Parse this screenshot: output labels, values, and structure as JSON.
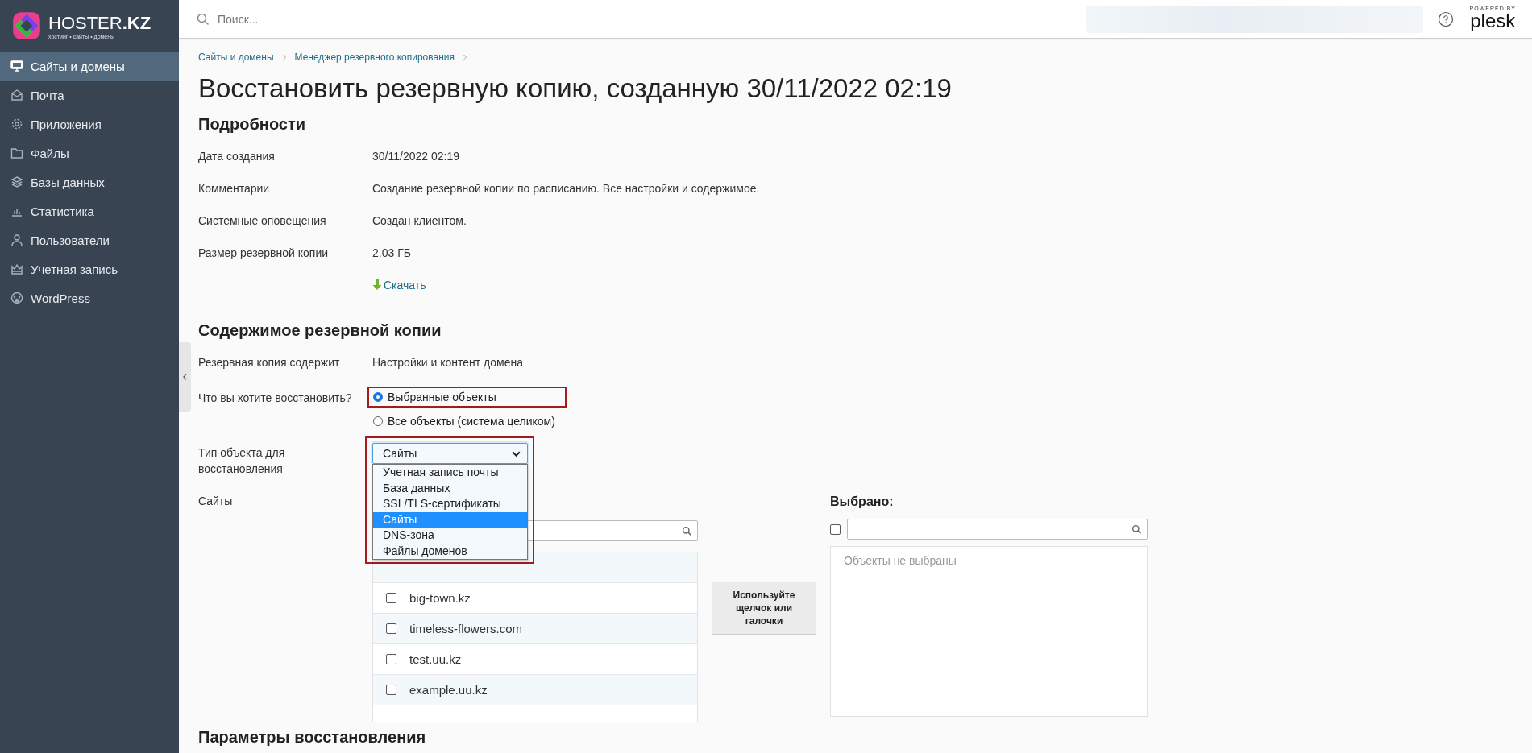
{
  "logo": {
    "name": "HOSTER",
    "suffix": ".KZ",
    "tagline": "хостинг • сайты • домены"
  },
  "sidebar": {
    "items": [
      {
        "label": "Сайты и домены",
        "selected": true
      },
      {
        "label": "Почта",
        "selected": false
      },
      {
        "label": "Приложения",
        "selected": false
      },
      {
        "label": "Файлы",
        "selected": false
      },
      {
        "label": "Базы данных",
        "selected": false
      },
      {
        "label": "Статистика",
        "selected": false
      },
      {
        "label": "Пользователи",
        "selected": false
      },
      {
        "label": "Учетная запись",
        "selected": false
      },
      {
        "label": "WordPress",
        "selected": false
      }
    ]
  },
  "search": {
    "placeholder": "Поиск..."
  },
  "plesk": {
    "powered": "POWERED BY",
    "name": "plesk"
  },
  "breadcrumbs": [
    "Сайты и домены",
    "Менеджер резервного копирования"
  ],
  "title": "Восстановить резервную копию, созданную 30/11/2022 02:19",
  "details": {
    "heading": "Подробности",
    "rows": [
      {
        "label": "Дата создания",
        "value": "30/11/2022 02:19"
      },
      {
        "label": "Комментарии",
        "value": "Создание резервной копии по расписанию. Все настройки и содержимое."
      },
      {
        "label": "Системные оповещения",
        "value": "Создан клиентом."
      },
      {
        "label": "Размер резервной копии",
        "value": "2.03 ГБ"
      }
    ],
    "download": "Скачать"
  },
  "contents": {
    "heading": "Содержимое резервной копии",
    "rows": [
      {
        "label": "Резервная копия содержит",
        "value": "Настройки и контент домена"
      }
    ],
    "restore_question": {
      "label": "Что вы хотите восстановить?",
      "options": [
        {
          "label": "Выбранные объекты",
          "selected": true
        },
        {
          "label": "Все объекты (система целиком)",
          "selected": false
        }
      ]
    },
    "object_type": {
      "label": "Тип объекта для восстановления",
      "value": "Сайты",
      "options": [
        {
          "label": "Учетная запись почты",
          "selected": false
        },
        {
          "label": "База данных",
          "selected": false
        },
        {
          "label": "SSL/TLS-сертификаты",
          "selected": false
        },
        {
          "label": "Сайты",
          "selected": true
        },
        {
          "label": "DNS-зона",
          "selected": false
        },
        {
          "label": "Файлы доменов",
          "selected": false
        }
      ]
    }
  },
  "sites": {
    "label": "Сайты",
    "rows": [
      {
        "name": "big-town.kz",
        "checked": false
      },
      {
        "name": "timeless-flowers.com",
        "checked": false
      },
      {
        "name": "test.uu.kz",
        "checked": false
      },
      {
        "name": "example.uu.kz",
        "checked": false
      }
    ],
    "hint_button": "Используйте щелчок или галочки",
    "selected_heading": "Выбрано:",
    "selected_all_checked": false,
    "empty": "Объекты не выбраны"
  },
  "next_heading": "Параметры восстановления"
}
